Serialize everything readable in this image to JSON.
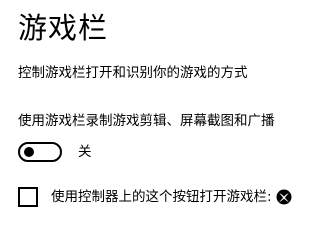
{
  "page": {
    "title": "游戏栏",
    "description": "控制游戏栏打开和识别你的游戏的方式"
  },
  "record_setting": {
    "label": "使用游戏栏录制游戏剪辑、屏幕截图和广播",
    "toggle_state": "关",
    "enabled": false
  },
  "controller_setting": {
    "label": "使用控制器上的这个按钮打开游戏栏:",
    "checked": false,
    "icon": "xbox-logo-icon"
  },
  "colors": {
    "text": "#000000",
    "background": "#ffffff"
  }
}
